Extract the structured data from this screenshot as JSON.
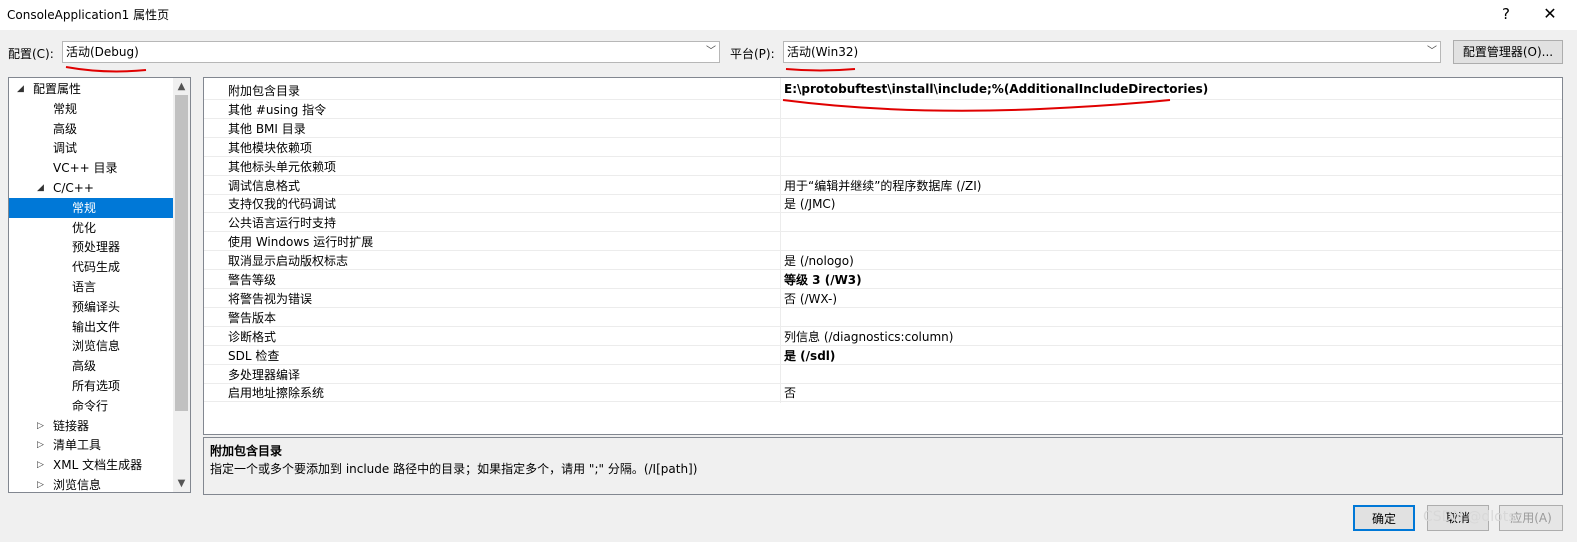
{
  "window": {
    "title": "ConsoleApplication1 属性页",
    "help": "?",
    "close": "✕"
  },
  "config": {
    "label": "配置(C):",
    "value": "活动(Debug)",
    "platform_label": "平台(P):",
    "platform_value": "活动(Win32)",
    "manager_button": "配置管理器(O)..."
  },
  "tree": {
    "items": [
      {
        "label": "配置属性",
        "expander": "◢"
      },
      {
        "label": "常规"
      },
      {
        "label": "高级"
      },
      {
        "label": "调试"
      },
      {
        "label": "VC++ 目录"
      },
      {
        "label": "C/C++",
        "expander": "◢"
      },
      {
        "label": "常规"
      },
      {
        "label": "优化"
      },
      {
        "label": "预处理器"
      },
      {
        "label": "代码生成"
      },
      {
        "label": "语言"
      },
      {
        "label": "预编译头"
      },
      {
        "label": "输出文件"
      },
      {
        "label": "浏览信息"
      },
      {
        "label": "高级"
      },
      {
        "label": "所有选项"
      },
      {
        "label": "命令行"
      },
      {
        "label": "链接器",
        "expander": "▷"
      },
      {
        "label": "清单工具",
        "expander": "▷"
      },
      {
        "label": "XML 文档生成器",
        "expander": "▷"
      },
      {
        "label": "浏览信息",
        "expander": "▷"
      }
    ],
    "selected_index": 6,
    "scroll_up": "▲",
    "scroll_down": "▼"
  },
  "properties": [
    {
      "name": "附加包含目录",
      "value": "E:\\protobuftest\\install\\include;%(AdditionalIncludeDirectories)",
      "bold": true
    },
    {
      "name": "其他 #using 指令",
      "value": ""
    },
    {
      "name": "其他 BMI 目录",
      "value": ""
    },
    {
      "name": "其他模块依赖项",
      "value": ""
    },
    {
      "name": "其他标头单元依赖项",
      "value": ""
    },
    {
      "name": "调试信息格式",
      "value": "用于“编辑并继续”的程序数据库 (/ZI)"
    },
    {
      "name": "支持仅我的代码调试",
      "value": "是 (/JMC)"
    },
    {
      "name": "公共语言运行时支持",
      "value": ""
    },
    {
      "name": "使用 Windows 运行时扩展",
      "value": ""
    },
    {
      "name": "取消显示启动版权标志",
      "value": "是 (/nologo)"
    },
    {
      "name": "警告等级",
      "value": "等级 3 (/W3)",
      "bold": true
    },
    {
      "name": "将警告视为错误",
      "value": "否 (/WX-)"
    },
    {
      "name": "警告版本",
      "value": ""
    },
    {
      "name": "诊断格式",
      "value": "列信息 (/diagnostics:column)"
    },
    {
      "name": "SDL 检查",
      "value": "是 (/sdl)",
      "bold": true
    },
    {
      "name": "多处理器编译",
      "value": ""
    },
    {
      "name": "启用地址擦除系统",
      "value": "否"
    }
  ],
  "description": {
    "title": "附加包含目录",
    "text": "指定一个或多个要添加到 include 路径中的目录；如果指定多个，请用 \";\" 分隔。(/I[path])"
  },
  "buttons": {
    "ok": "确定",
    "cancel": "取消",
    "apply": "应用(A)"
  },
  "watermark": "CSDN @dlots",
  "annotation_color": "#e00000"
}
